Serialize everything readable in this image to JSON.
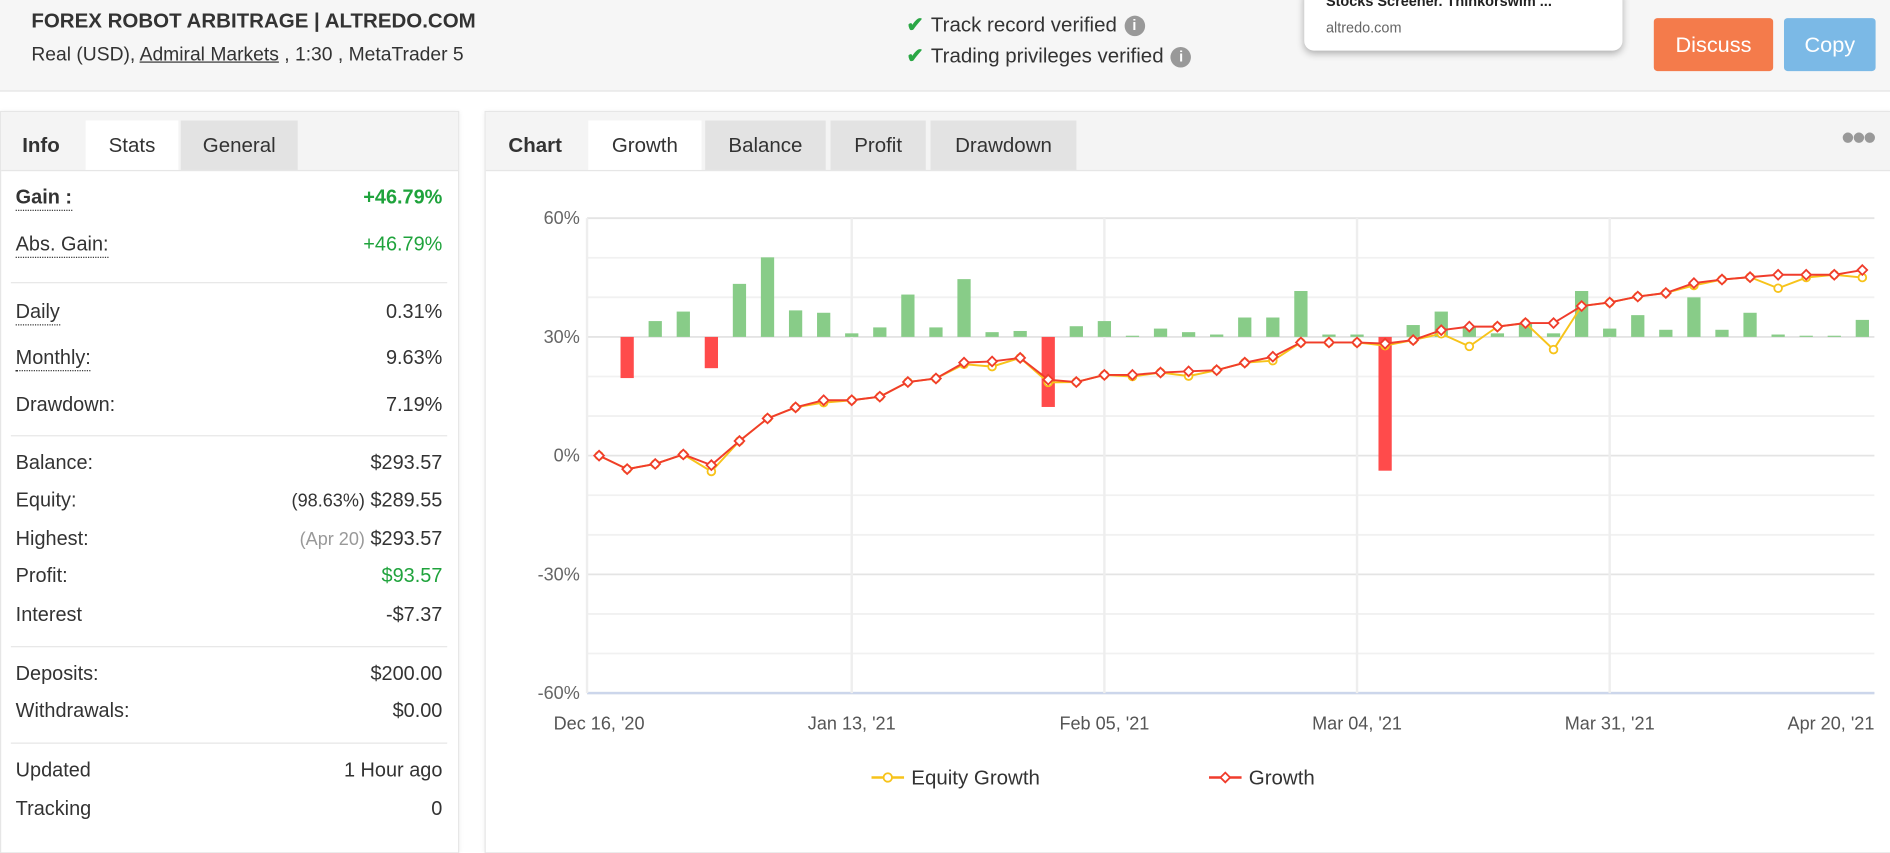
{
  "header": {
    "title": "FOREX ROBOT ARBITRAGE | ALTREDO.COM",
    "account_type": "Real (USD),",
    "broker": "Admiral Markets",
    "leverage": " , 1:30 , MetaTrader 5",
    "verified": [
      "Track record verified",
      "Trading privileges verified"
    ],
    "popup": {
      "title": "Stocks Screener. Thinkorswim ...",
      "domain": "altredo.com"
    },
    "discuss_label": "Discuss",
    "copy_label": "Copy",
    "colors": {
      "discuss": "#f47b4b",
      "copy": "#7bb9e6"
    }
  },
  "left": {
    "tabs": [
      "Info",
      "Stats",
      "General"
    ],
    "active_tab": "Stats",
    "rows": [
      {
        "label": "Gain :",
        "value": "+46.79%"
      },
      {
        "label": "Abs. Gain:",
        "value": "+46.79%"
      },
      {
        "label": "Daily",
        "value": "0.31%"
      },
      {
        "label": "Monthly:",
        "value": "9.63%"
      },
      {
        "label": "Drawdown:",
        "value": "7.19%"
      },
      {
        "label": "Balance:",
        "value": "$293.57"
      },
      {
        "label": "Equity:",
        "note": "(98.63%)",
        "value": "$289.55"
      },
      {
        "label": "Highest:",
        "note": "(Apr 20)",
        "value": "$293.57"
      },
      {
        "label": "Profit:",
        "value": "$93.57"
      },
      {
        "label": "Interest",
        "value": "-$7.37"
      },
      {
        "label": "Deposits:",
        "value": "$200.00"
      },
      {
        "label": "Withdrawals:",
        "value": "$0.00"
      },
      {
        "label": "Updated",
        "value": "1 Hour ago"
      },
      {
        "label": "Tracking",
        "value": "0"
      }
    ]
  },
  "right": {
    "tabs": [
      "Chart",
      "Growth",
      "Balance",
      "Profit",
      "Drawdown"
    ],
    "active_tab": "Growth",
    "menu_icon": "more-dots-icon"
  },
  "chart_data": {
    "type": "line",
    "ylim": [
      -60,
      60
    ],
    "yticks": [
      "60%",
      "30%",
      "0%",
      "-30%",
      "-60%"
    ],
    "xtick_labels": [
      "Dec 16, '20",
      "Jan 13, '21",
      "Feb 05, '21",
      "Mar 04, '21",
      "Mar 31, '21",
      "Apr 20, '21"
    ],
    "grid": true,
    "legend": "bottom",
    "series": [
      {
        "name": "Equity Growth",
        "color": "#f7c31a",
        "values": [
          0,
          -3.4,
          -2.1,
          0.3,
          -4,
          3.7,
          9.4,
          12.2,
          13.4,
          14,
          14.9,
          18.6,
          19.5,
          23.1,
          22.5,
          24.7,
          18.5,
          18.6,
          20.4,
          20,
          21,
          20.1,
          21.6,
          23.5,
          24,
          28.6,
          28.6,
          28.6,
          27.8,
          29.2,
          30.8,
          27.6,
          32.6,
          33.5,
          26.8,
          37.8,
          38.7,
          40.2,
          41.1,
          43,
          44.5,
          45.1,
          42.3,
          45,
          45.7,
          45
        ]
      },
      {
        "name": "Growth",
        "color": "#f03c2c",
        "values": [
          0,
          -3.4,
          -2.1,
          0.3,
          -2.4,
          3.7,
          9.4,
          12.2,
          14,
          14,
          14.9,
          18.6,
          19.5,
          23.5,
          23.8,
          24.7,
          19.2,
          18.6,
          20.4,
          20.4,
          21,
          21.3,
          21.6,
          23.5,
          25,
          28.6,
          28.6,
          28.6,
          28.3,
          29.2,
          31.7,
          32.6,
          32.6,
          33.5,
          33.5,
          37.8,
          38.7,
          40.2,
          41.1,
          43.6,
          44.5,
          45.1,
          45.7,
          45.7,
          45.7,
          46.9
        ]
      }
    ],
    "bars": {
      "baseline": 30,
      "positive_color": "#88cc88",
      "negative_color": "#ff4b4b",
      "values": [
        0,
        -10.4,
        4,
        6.4,
        -7.9,
        13.4,
        20.1,
        6.7,
        6.1,
        0.9,
        2.4,
        10.7,
        2.4,
        14.6,
        1.2,
        1.5,
        -17.7,
        2.7,
        4,
        0.3,
        2.1,
        1.2,
        0.6,
        4.9,
        4.9,
        11.6,
        0.6,
        0.6,
        -33.8,
        3,
        6.4,
        2.7,
        0.9,
        3.4,
        0.9,
        11.6,
        2.1,
        5.5,
        1.8,
        10,
        1.8,
        6.1,
        0.6,
        0.3,
        0.3,
        4.3
      ]
    }
  }
}
